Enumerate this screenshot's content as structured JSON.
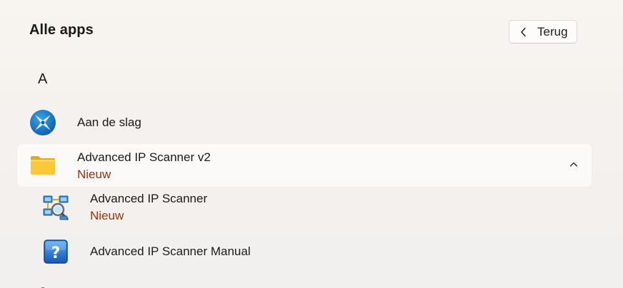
{
  "header": {
    "title": "Alle apps",
    "back_label": "Terug"
  },
  "sections": [
    {
      "letter": "A",
      "apps": [
        {
          "name": "Aan de slag",
          "icon": "get-started-icon"
        },
        {
          "name": "Advanced IP Scanner v2",
          "badge": "Nieuw",
          "icon": "folder-icon",
          "expanded": true,
          "children": [
            {
              "name": "Advanced IP Scanner",
              "badge": "Nieuw",
              "icon": "network-scanner-icon"
            },
            {
              "name": "Advanced IP Scanner Manual",
              "icon": "help-icon"
            }
          ]
        }
      ]
    }
  ],
  "colors": {
    "badge": "#a0300b",
    "accent": "#1c6fb8"
  }
}
